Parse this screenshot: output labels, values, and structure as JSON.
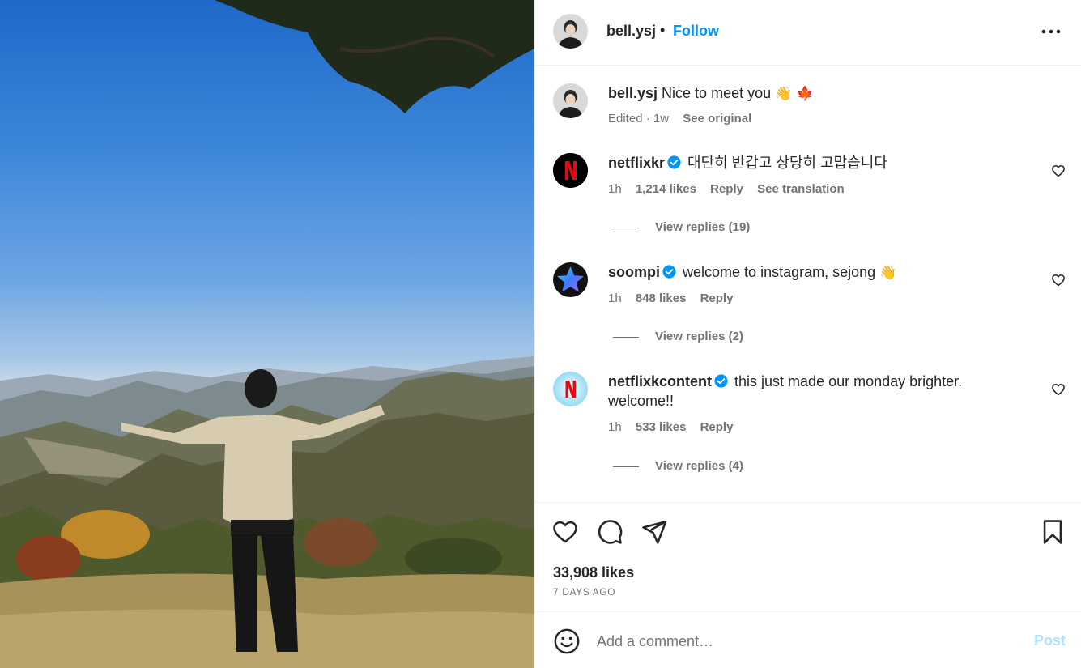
{
  "post": {
    "author": "bell.ysj",
    "separator": "•",
    "follow_label": "Follow",
    "more_label": "More options"
  },
  "caption": {
    "username": "bell.ysj",
    "text": "Nice to meet you",
    "emojis": "👋 🍁",
    "edited": "Edited · 1w",
    "see_original": "See original"
  },
  "comments": [
    {
      "username": "netflixkr",
      "verified": true,
      "text": "대단히 반갑고 상당히 고맙습니다",
      "time": "1h",
      "likes": "1,214 likes",
      "reply": "Reply",
      "translation": "See translation",
      "view_replies": "View replies (19)",
      "avatar_icon": "netflix-logo"
    },
    {
      "username": "soompi",
      "verified": true,
      "text": "welcome to instagram, sejong",
      "emoji": "👋",
      "time": "1h",
      "likes": "848 likes",
      "reply": "Reply",
      "view_replies": "View replies (2)",
      "avatar_icon": "star-logo"
    },
    {
      "username": "netflixkcontent",
      "verified": true,
      "text": "this just made our monday brighter. welcome!!",
      "time": "1h",
      "likes": "533 likes",
      "reply": "Reply",
      "view_replies": "View replies (4)",
      "avatar_icon": "netflix-logo"
    }
  ],
  "stats": {
    "likes": "33,908 likes",
    "date": "7 DAYS AGO"
  },
  "add_comment": {
    "placeholder": "Add a comment…",
    "post_label": "Post"
  },
  "colors": {
    "accent": "#0095f6",
    "post_disabled": "#b2dffc",
    "secondary_text": "#737373",
    "netflix_red": "#e50914"
  }
}
